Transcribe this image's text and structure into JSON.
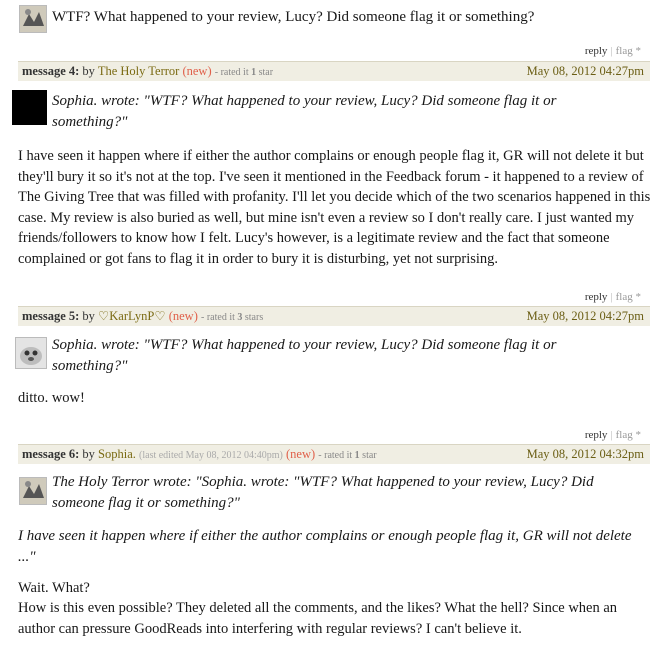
{
  "top": {
    "text": "WTF? What happened to your review, Lucy? Did someone flag it or something?",
    "reply": "reply",
    "flag": "flag *"
  },
  "messages": [
    {
      "label": "message 4:",
      "by": "by",
      "user": "The Holy Terror",
      "new": "(new)",
      "rated_pre": "- rated it ",
      "rated_num": "1",
      "rated_post": " star",
      "date": "May 08, 2012 04:27pm",
      "quote": "Sophia. wrote: \"WTF? What happened to your review, Lucy? Did someone flag it or something?\"",
      "body": "I have seen it happen where if either the author complains or enough people flag it, GR will not delete it but they'll bury it so it's not at the top. I've seen it mentioned in the Feedback forum - it happened to a review of The Giving Tree that was filled with profanity. I'll let you decide which of the two scenarios happened in this case. My review is also buried as well, but mine isn't even a review so I don't really care. I just wanted my friends/followers to know how I felt. Lucy's however, is a legitimate review and the fact that someone complained or got fans to flag it in order to bury it is disturbing, yet not surprising.",
      "reply": "reply",
      "flag": "flag *"
    },
    {
      "label": "message 5:",
      "by": "by",
      "user": "♡KarLynP♡",
      "new": "(new)",
      "rated_pre": "- rated it ",
      "rated_num": "3",
      "rated_post": " stars",
      "date": "May 08, 2012 04:27pm",
      "quote": "Sophia. wrote: \"WTF? What happened to your review, Lucy? Did someone flag it or something?\"",
      "body": "ditto. wow!",
      "reply": "reply",
      "flag": "flag *"
    },
    {
      "label": "message 6:",
      "by": "by",
      "user": "Sophia.",
      "edited": "(last edited May 08, 2012 04:40pm)",
      "new": "(new)",
      "rated_pre": "- rated it ",
      "rated_num": "1",
      "rated_post": " star",
      "date": "May 08, 2012 04:32pm",
      "quote": "The Holy Terror wrote: \"Sophia. wrote: \"WTF? What happened to your review, Lucy? Did someone flag it or something?\"",
      "quote2": "I have seen it happen where if either the author complains or enough people flag it, GR will not delete ...\"",
      "body1": "Wait. What?",
      "body2": "How is this even possible? They deleted all the comments, and the likes? What the hell? Since when an author can pressure GoodReads into interfering with regular reviews? I can't believe it."
    }
  ],
  "icons": {
    "avatar_sophia": "avatar-sophia-icon",
    "avatar_holy_terror": "avatar-holy-terror-icon",
    "avatar_karlynp": "avatar-karlynp-icon"
  },
  "colors": {
    "header_bg": "#f0eee3",
    "username": "#7a6a12",
    "new_badge": "#e0604a",
    "date": "#6b5e14"
  }
}
